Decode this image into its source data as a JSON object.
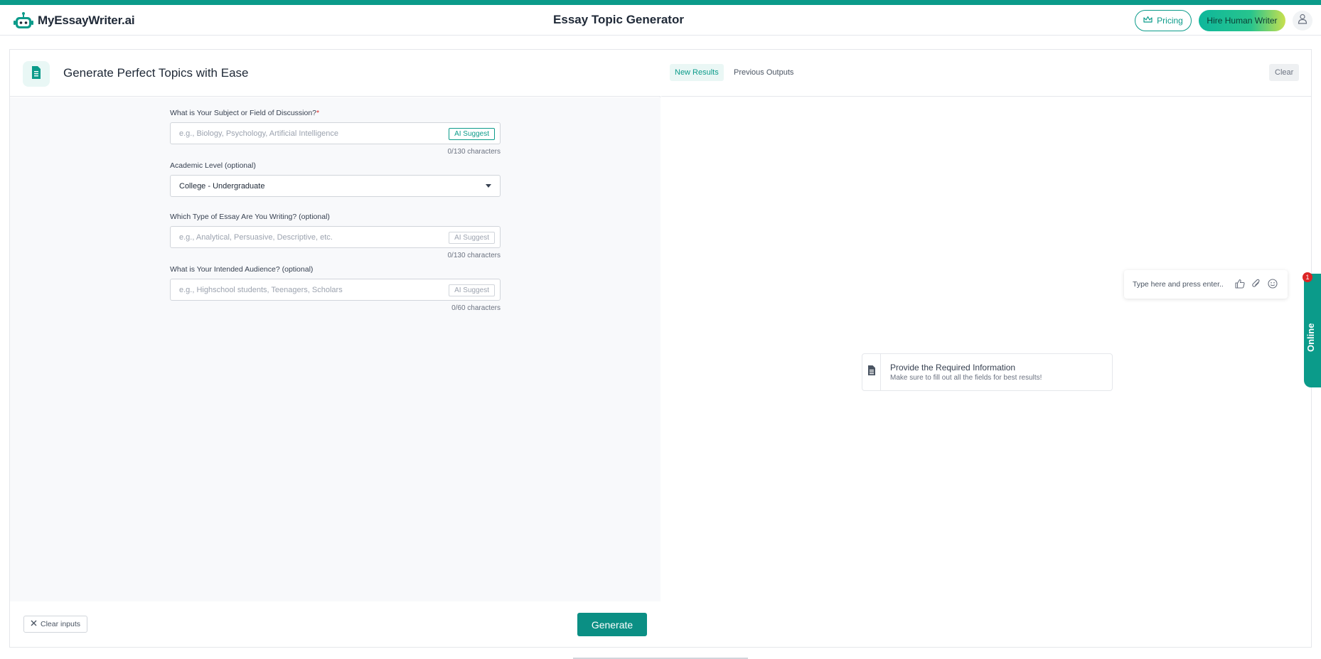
{
  "header": {
    "brand": "MyEssayWriter.ai",
    "title": "Essay Topic Generator",
    "pricing_label": "Pricing",
    "hire_label": "Hire Human Writer"
  },
  "form": {
    "heading": "Generate Perfect Topics with Ease",
    "subject": {
      "label": "What is Your Subject or Field of Discussion?",
      "required_mark": "*",
      "placeholder": "e.g., Biology, Psychology, Artificial Intelligence",
      "value": "",
      "ai_label": "AI Suggest",
      "count": "0/130 characters"
    },
    "level": {
      "label": "Academic Level (optional)",
      "selected": "College - Undergraduate"
    },
    "essay_type": {
      "label": "Which Type of Essay Are You Writing? (optional)",
      "placeholder": "e.g., Analytical, Persuasive, Descriptive, etc.",
      "value": "",
      "ai_label": "AI Suggest",
      "count": "0/130 characters"
    },
    "audience": {
      "label": "What is Your Intended Audience? (optional)",
      "placeholder": "e.g., Highschool students, Teenagers, Scholars",
      "value": "",
      "ai_label": "AI Suggest",
      "count": "0/60 characters"
    },
    "clear_label": "Clear inputs",
    "generate_label": "Generate"
  },
  "results": {
    "tab_new": "New Results",
    "tab_previous": "Previous Outputs",
    "clear_label": "Clear",
    "empty_title": "Provide the Required Information",
    "empty_subtitle": "Make sure to fill out all the fields for best results!"
  },
  "chat": {
    "placeholder": "Type here and press enter..",
    "online_label": "Online",
    "badge_count": "1"
  },
  "colors": {
    "accent": "#0b9b8a",
    "generate": "#0b8f84",
    "required": "#dc2626"
  }
}
